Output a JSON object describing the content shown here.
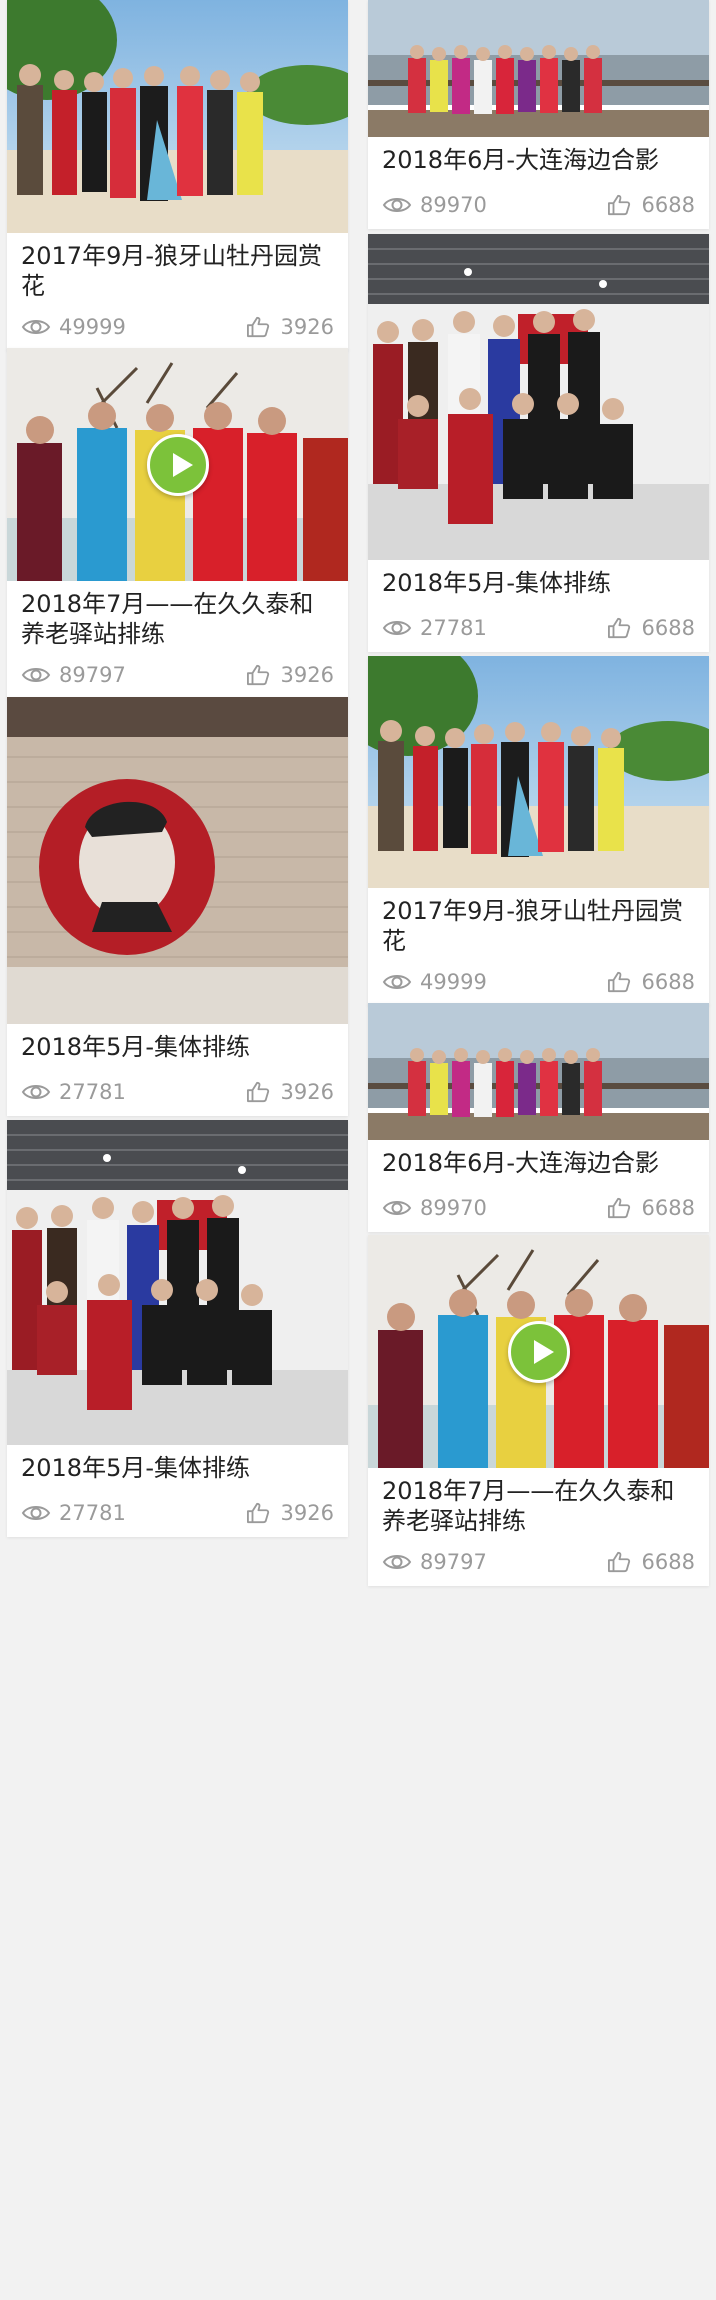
{
  "cards": [
    {
      "title": "2017年9月-狼牙山牡丹园赏花",
      "views": "49999",
      "likes": "3926"
    },
    {
      "title": "2018年6月-大连海边合影",
      "views": "89970",
      "likes": "6688"
    },
    {
      "title": "2018年7月——在久久泰和养老驿站排练",
      "views": "89797",
      "likes": "3926"
    },
    {
      "title": "2018年5月-集体排练",
      "views": "27781",
      "likes": "6688"
    },
    {
      "title": "2018年5月-集体排练",
      "views": "27781",
      "likes": "3926"
    },
    {
      "title": "2017年9月-狼牙山牡丹园赏花",
      "views": "49999",
      "likes": "6688"
    },
    {
      "title": "2018年6月-大连海边合影",
      "views": "89970",
      "likes": "6688"
    },
    {
      "title": "2018年5月-集体排练",
      "views": "27781",
      "likes": "3926"
    },
    {
      "title": "2018年7月——在久久泰和养老驿站排练",
      "views": "89797",
      "likes": "6688"
    }
  ],
  "icons": {
    "views": "eye-icon",
    "likes": "thumbs-up-icon",
    "video": "play-icon"
  },
  "colors": {
    "play_button": "#7cc23a",
    "meta_text": "#9a9a9a"
  }
}
